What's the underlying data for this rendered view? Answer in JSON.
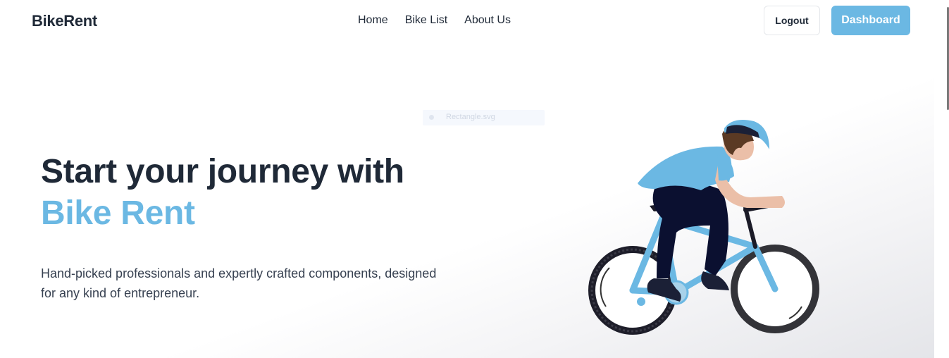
{
  "brand": {
    "name": "BikeRent"
  },
  "nav": {
    "links": [
      {
        "label": "Home"
      },
      {
        "label": "Bike List"
      },
      {
        "label": "About Us"
      }
    ]
  },
  "actions": {
    "logout_label": "Logout",
    "dashboard_label": "Dashboard"
  },
  "hero": {
    "headline": "Start your journey with",
    "headline_accent": "Bike Rent",
    "description": "Hand-picked professionals and expertly crafted components, designed for any kind of entrepreneur.",
    "image_alt": "Rectangle.svg",
    "illustration": "cyclist-illustration"
  },
  "colors": {
    "accent": "#6bb8e3",
    "text": "#1f2937",
    "dark_navy": "#0b1030"
  }
}
